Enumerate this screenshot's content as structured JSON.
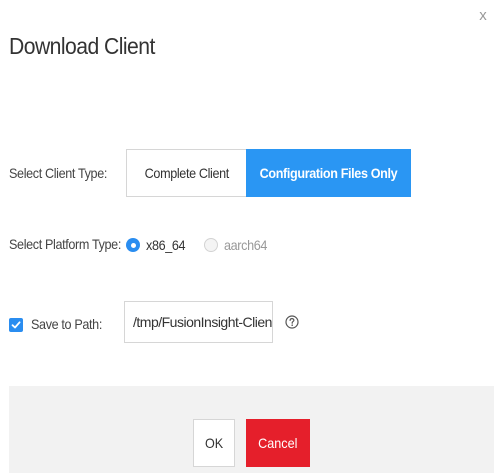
{
  "dialog": {
    "title": "Download Client",
    "close_label": "x"
  },
  "client_type": {
    "label": "Select Client Type:",
    "options": [
      "Complete Client",
      "Configuration Files Only"
    ],
    "selected": "Configuration Files Only"
  },
  "platform_type": {
    "label": "Select Platform Type:",
    "options": [
      "x86_64",
      "aarch64"
    ],
    "selected": "x86_64"
  },
  "save_path": {
    "label": "Save to Path:",
    "checked": true,
    "value": "/tmp/FusionInsight-Client/"
  },
  "footer": {
    "ok_label": "OK",
    "cancel_label": "Cancel"
  },
  "colors": {
    "accent": "#2a96f3",
    "danger": "#e51f2b",
    "footer_bg": "#f2f2f2"
  },
  "icons": {
    "close": "close-icon",
    "help": "question-circle-icon",
    "check": "checkmark-icon"
  }
}
